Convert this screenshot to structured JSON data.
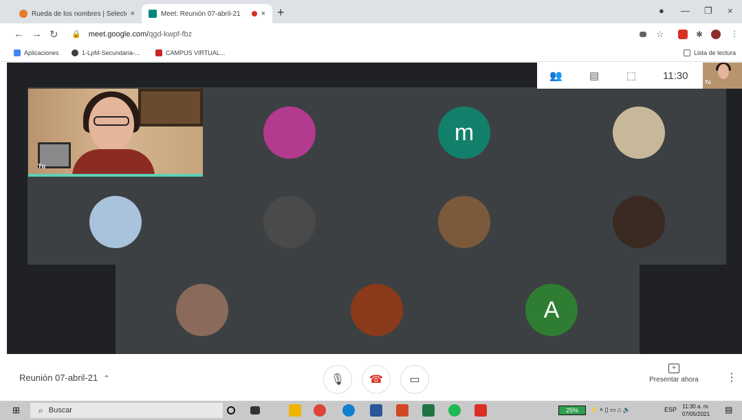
{
  "browser": {
    "tabs": [
      {
        "title": "Rueda de los nombres | Selector",
        "active": false
      },
      {
        "title": "Meet: Reunión 07-abril-21",
        "active": true
      }
    ],
    "new_tab_symbol": "+",
    "close_symbol": "×",
    "url_host": "meet.google.com/",
    "url_path": "qgd-kwpf-fbz",
    "bookmarks": [
      "Aplicaciones",
      "1-LpM-Secundaria-...",
      "CAMPUS VIRTUAL..."
    ],
    "reading_list": "Lista de lectura"
  },
  "meet": {
    "top_time": "11:30",
    "self_label": "Tú",
    "pip_label": "Tú",
    "participants": [
      {
        "initial": "",
        "color": "#b23a8f"
      },
      {
        "initial": "m",
        "color": "#12806b"
      },
      {
        "initial": "",
        "color": "#c8b89a"
      },
      {
        "initial": "",
        "color": "#a9c3dd"
      },
      {
        "initial": "",
        "color": "#4a4a4a"
      },
      {
        "initial": "",
        "color": "#7a5a3a"
      },
      {
        "initial": "",
        "color": "#3a2a22"
      },
      {
        "initial": "",
        "color": "#8a6a5a"
      },
      {
        "initial": "",
        "color": "#8a3a1a"
      },
      {
        "initial": "A",
        "color": "#2f7d32"
      }
    ],
    "meeting_name": "Reunión 07-abril-21",
    "present_label": "Presentar ahora"
  },
  "taskbar": {
    "search_placeholder": "Buscar",
    "battery": "25%",
    "lang": "ESP",
    "time": "11:30 a. m.",
    "date": "07/05/2021"
  }
}
